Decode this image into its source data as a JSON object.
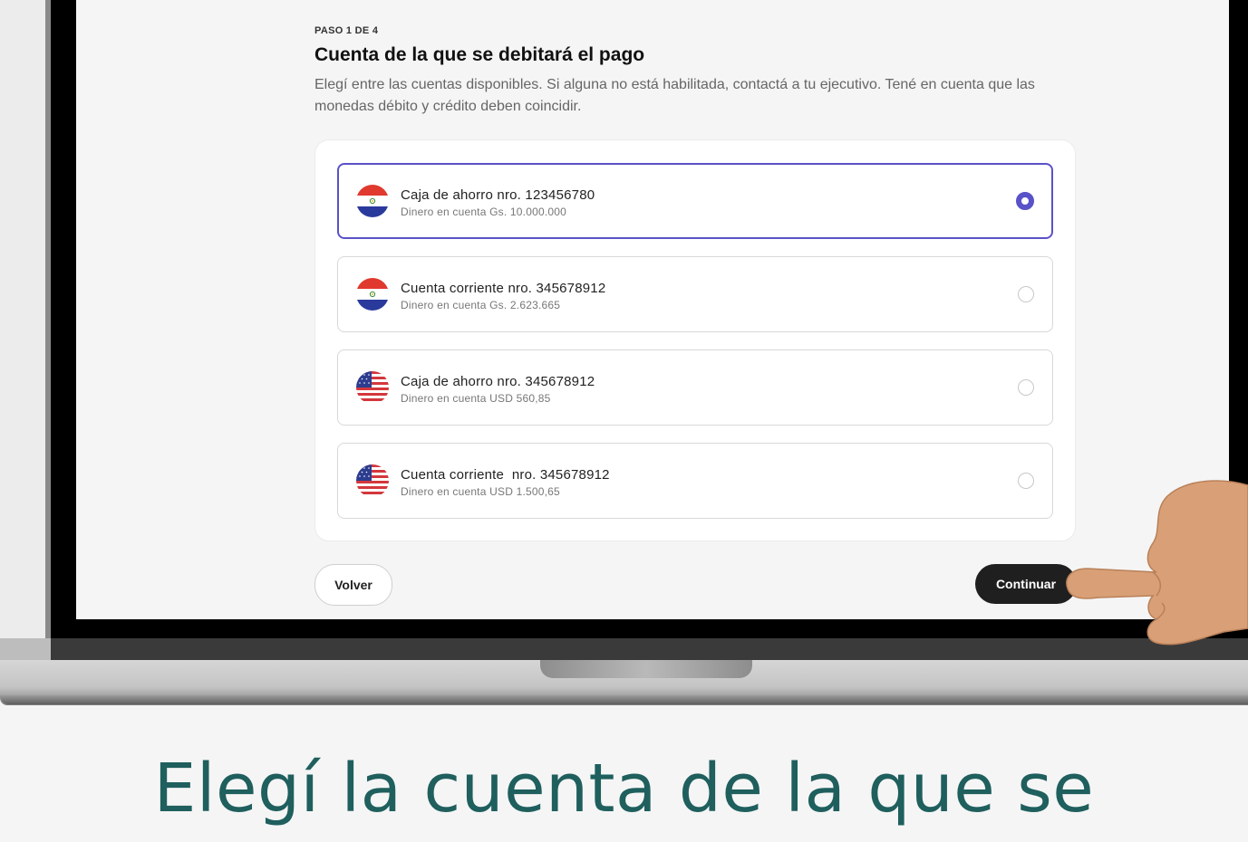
{
  "step_label": "PASO 1 DE 4",
  "title": "Cuenta de la que se debitará el pago",
  "description": "Elegí entre las cuentas disponibles. Si alguna no está habilitada, contactá a tu ejecutivo. Tené en cuenta que las monedas débito y crédito deben coincidir.",
  "accounts": [
    {
      "name": "Caja de ahorro nro. 123456780",
      "balance": "Dinero en cuenta Gs. 10.000.000",
      "flag": "paraguay-flag-icon",
      "selected": true
    },
    {
      "name": "Cuenta corriente nro. 345678912",
      "balance": "Dinero en cuenta Gs. 2.623.665",
      "flag": "paraguay-flag-icon",
      "selected": false
    },
    {
      "name": "Caja de ahorro nro. 345678912",
      "balance": "Dinero en cuenta USD 560,85",
      "flag": "usa-flag-icon",
      "selected": false
    },
    {
      "name": "Cuenta corriente  nro. 345678912",
      "balance": "Dinero en cuenta USD 1.500,65",
      "flag": "usa-flag-icon",
      "selected": false
    }
  ],
  "buttons": {
    "back": "Volver",
    "continue": "Continuar"
  },
  "caption": "Elegí la cuenta de la que se",
  "colors": {
    "accent": "#5a52c8",
    "primary_button": "#1f1f1f",
    "caption": "#1f5f5d"
  }
}
